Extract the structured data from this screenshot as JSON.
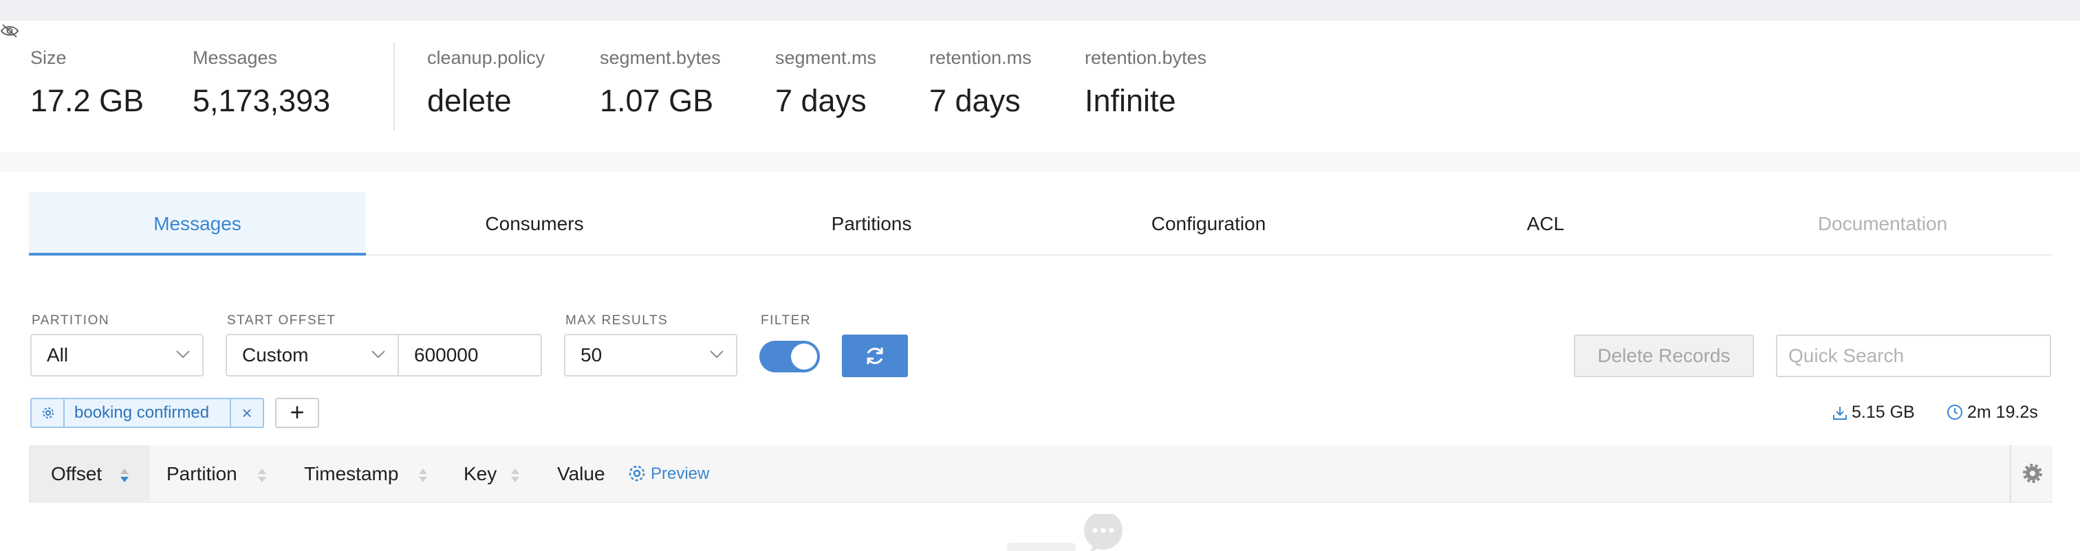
{
  "stats": {
    "size": {
      "label": "Size",
      "value": "17.2 GB"
    },
    "messages": {
      "label": "Messages",
      "value": "5,173,393"
    },
    "config": [
      {
        "label": "cleanup.policy",
        "value": "delete"
      },
      {
        "label": "segment.bytes",
        "value": "1.07 GB"
      },
      {
        "label": "segment.ms",
        "value": "7 days"
      },
      {
        "label": "retention.ms",
        "value": "7 days"
      },
      {
        "label": "retention.bytes",
        "value": "Infinite"
      }
    ]
  },
  "tabs": [
    {
      "label": "Messages"
    },
    {
      "label": "Consumers"
    },
    {
      "label": "Partitions"
    },
    {
      "label": "Configuration"
    },
    {
      "label": "ACL"
    },
    {
      "label": "Documentation"
    }
  ],
  "filters": {
    "partition": {
      "label": "PARTITION",
      "value": "All"
    },
    "start_offset": {
      "label": "START OFFSET",
      "mode": "Custom",
      "value": "600000"
    },
    "max_results": {
      "label": "MAX RESULTS",
      "value": "50"
    },
    "filter": {
      "label": "FILTER"
    }
  },
  "actions": {
    "delete_records": "Delete Records",
    "quick_search_placeholder": "Quick Search"
  },
  "filter_chip": {
    "label": "booking confirmed",
    "remove": "×"
  },
  "add_filter": "+",
  "meta": {
    "bytes": "5.15 GB",
    "elapsed": "2m 19.2s"
  },
  "table": {
    "columns": [
      "Offset",
      "Partition",
      "Timestamp",
      "Key",
      "Value"
    ],
    "preview_label": "Preview"
  },
  "colors": {
    "accent": "#4a88d4",
    "accent_text": "#3a86cf",
    "chip_bg": "#e9f4fe"
  }
}
